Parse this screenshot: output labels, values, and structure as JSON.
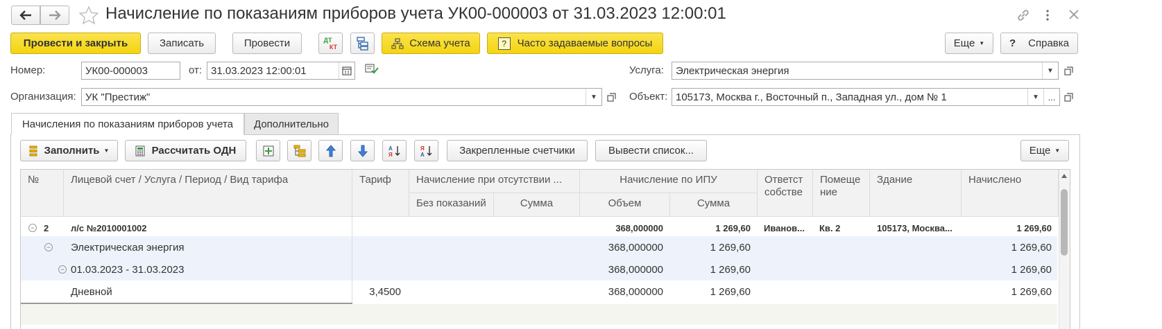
{
  "window": {
    "title": "Начисление по показаниям приборов учета УК00-000003 от 31.03.2023 12:00:01"
  },
  "toolbar": {
    "post_close": "Провести и закрыть",
    "save": "Записать",
    "post": "Провести",
    "dtkt_dt": "ДТ",
    "dtkt_kt": "КТ",
    "scheme": "Схема учета",
    "faq": "Часто задаваемые вопросы",
    "more": "Еще",
    "help": "Справка",
    "help_q": "?"
  },
  "form": {
    "number_label": "Номер:",
    "number_value": "УК00-000003",
    "date_label": "от:",
    "date_value": "31.03.2023 12:00:01",
    "org_label": "Организация:",
    "org_value": "УК \"Престиж\"",
    "service_label": "Услуга:",
    "service_value": "Электрическая энергия",
    "object_label": "Объект:",
    "object_value": "105173, Москва г., Восточный п., Западная ул., дом № 1",
    "ellipsis": "..."
  },
  "tabs": [
    {
      "label": "Начисления по показаниям приборов учета"
    },
    {
      "label": "Дополнительно"
    }
  ],
  "table_toolbar": {
    "fill": "Заполнить",
    "calc_odn": "Рассчитать ОДН",
    "fixed_meters": "Закрепленные счетчики",
    "print_list": "Вывести список...",
    "more": "Еще"
  },
  "table": {
    "headers": {
      "num": "№",
      "account": "Лицевой счет / Услуга / Период / Вид тарифа",
      "tariff": "Тариф",
      "no_meter": "Начисление при отсутствии ...",
      "no_readings": "Без показаний",
      "sum1": "Сумма",
      "ipu": "Начисление по ИПУ",
      "volume": "Объем",
      "sum2": "Сумма",
      "owner": "Ответст собстве",
      "room": "Помеще ние",
      "building": "Здание",
      "accrued": "Начислено"
    },
    "rows": [
      {
        "num": "2",
        "account": "л/с №2010001002",
        "tariff": "",
        "volume": "368,000000",
        "sum": "1 269,60",
        "owner": "Иванов...",
        "room": "Кв. 2",
        "building": "105173, Москва...",
        "accrued": "1 269,60"
      },
      {
        "num": "",
        "account": "Электрическая энергия",
        "tariff": "",
        "volume": "368,000000",
        "sum": "1 269,60",
        "owner": "",
        "room": "",
        "building": "",
        "accrued": "1 269,60"
      },
      {
        "num": "",
        "account": "01.03.2023 - 31.03.2023",
        "tariff": "",
        "volume": "368,000000",
        "sum": "1 269,60",
        "owner": "",
        "room": "",
        "building": "",
        "accrued": "1 269,60"
      },
      {
        "num": "",
        "account": "Дневной",
        "tariff": "3,4500",
        "volume": "368,000000",
        "sum": "1 269,60",
        "owner": "",
        "room": "",
        "building": "",
        "accrued": "1 269,60"
      }
    ]
  },
  "colors": {
    "accent_yellow": "#f4d411",
    "selected_row": "#eef3fb",
    "green_mark": "#3a9a3a"
  }
}
